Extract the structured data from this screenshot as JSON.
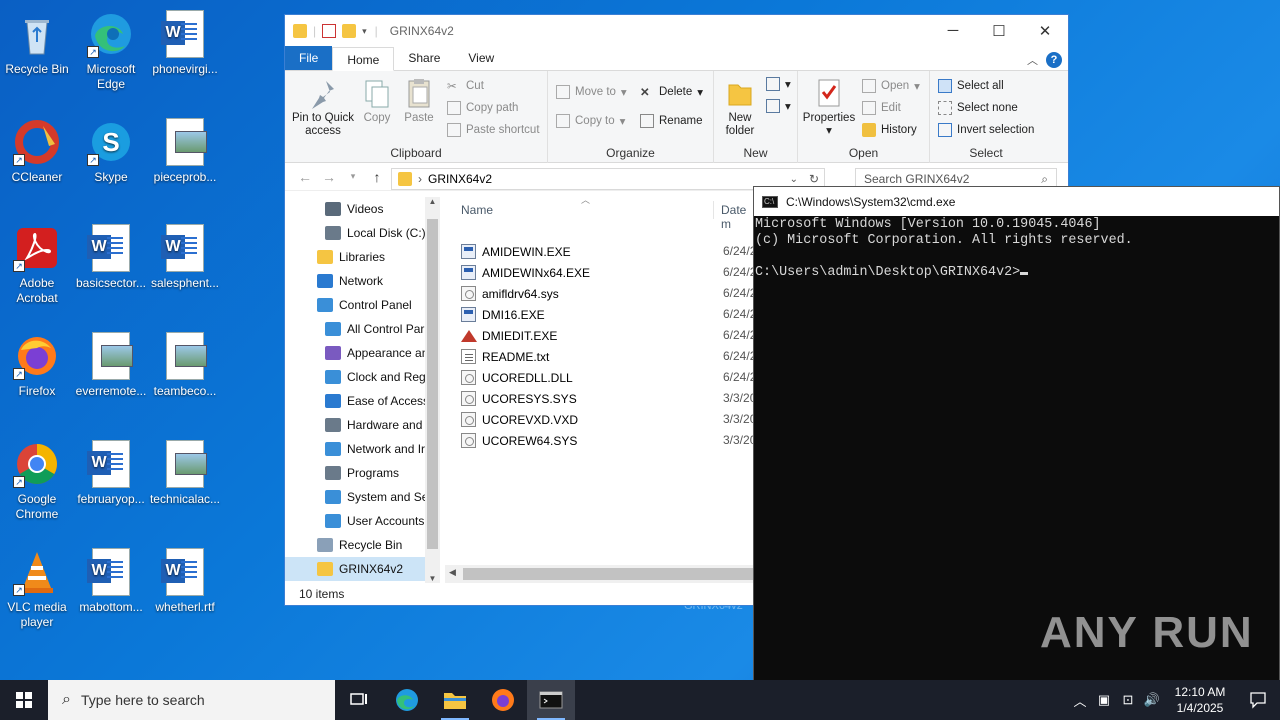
{
  "desktop": {
    "icons": [
      {
        "label": "Recycle Bin",
        "icon": "recycle-bin-icon"
      },
      {
        "label": "Microsoft Edge",
        "icon": "edge-icon"
      },
      {
        "label": "phonevirgi...",
        "icon": "word-document-icon"
      },
      {
        "label": "CCleaner",
        "icon": "ccleaner-icon"
      },
      {
        "label": "Skype",
        "icon": "skype-icon"
      },
      {
        "label": "pieceprob...",
        "icon": "image-file-icon"
      },
      {
        "label": "Adobe Acrobat",
        "icon": "acrobat-icon"
      },
      {
        "label": "basicsector...",
        "icon": "word-document-icon"
      },
      {
        "label": "salesphent...",
        "icon": "word-document-icon"
      },
      {
        "label": "Firefox",
        "icon": "firefox-icon"
      },
      {
        "label": "everremote...",
        "icon": "image-file-icon"
      },
      {
        "label": "teambeco...",
        "icon": "image-file-icon"
      },
      {
        "label": "Google Chrome",
        "icon": "chrome-icon"
      },
      {
        "label": "februaryop...",
        "icon": "word-document-icon"
      },
      {
        "label": "technicalac...",
        "icon": "image-file-icon"
      },
      {
        "label": "VLC media player",
        "icon": "vlc-icon"
      },
      {
        "label": "mabottom...",
        "icon": "word-document-icon"
      },
      {
        "label": "whetherl.rtf",
        "icon": "word-document-icon"
      }
    ]
  },
  "explorer": {
    "title": "GRINX64v2",
    "tabs": {
      "file": "File",
      "home": "Home",
      "share": "Share",
      "view": "View"
    },
    "ribbon": {
      "clipboard": {
        "label": "Clipboard",
        "pin": "Pin to Quick access",
        "copy": "Copy",
        "paste": "Paste",
        "cut": "Cut",
        "copy_path": "Copy path",
        "paste_shortcut": "Paste shortcut"
      },
      "organize": {
        "label": "Organize",
        "move_to": "Move to",
        "copy_to": "Copy to",
        "delete": "Delete",
        "rename": "Rename"
      },
      "new": {
        "label": "New",
        "new_folder": "New folder"
      },
      "open": {
        "label": "Open",
        "properties": "Properties",
        "open": "Open",
        "edit": "Edit",
        "history": "History"
      },
      "select": {
        "label": "Select",
        "select_all": "Select all",
        "select_none": "Select none",
        "invert": "Invert selection"
      }
    },
    "address": {
      "path": "GRINX64v2",
      "search_placeholder": "Search GRINX64v2"
    },
    "nav_items": [
      {
        "label": "Videos",
        "indent": 1
      },
      {
        "label": "Local Disk (C:)",
        "indent": 1
      },
      {
        "label": "Libraries",
        "indent": 0
      },
      {
        "label": "Network",
        "indent": 0
      },
      {
        "label": "Control Panel",
        "indent": 0
      },
      {
        "label": "All Control Par",
        "indent": 1
      },
      {
        "label": "Appearance an",
        "indent": 1
      },
      {
        "label": "Clock and Regi",
        "indent": 1
      },
      {
        "label": "Ease of Access",
        "indent": 1
      },
      {
        "label": "Hardware and",
        "indent": 1
      },
      {
        "label": "Network and Ir",
        "indent": 1
      },
      {
        "label": "Programs",
        "indent": 1
      },
      {
        "label": "System and Se",
        "indent": 1
      },
      {
        "label": "User Accounts",
        "indent": 1
      },
      {
        "label": "Recycle Bin",
        "indent": 0
      },
      {
        "label": "GRINX64v2",
        "indent": 0,
        "selected": true
      }
    ],
    "columns": {
      "name": "Name",
      "date": "Date m"
    },
    "files": [
      {
        "name": "AMIDEWIN.EXE",
        "date": "6/24/2",
        "type": "exe"
      },
      {
        "name": "AMIDEWINx64.EXE",
        "date": "6/24/2",
        "type": "exe"
      },
      {
        "name": "amifldrv64.sys",
        "date": "6/24/2",
        "type": "sys"
      },
      {
        "name": "DMI16.EXE",
        "date": "6/24/2",
        "type": "exe"
      },
      {
        "name": "DMIEDIT.EXE",
        "date": "6/24/2",
        "type": "edit"
      },
      {
        "name": "README.txt",
        "date": "6/24/2",
        "type": "txt"
      },
      {
        "name": "UCOREDLL.DLL",
        "date": "6/24/2",
        "type": "sys"
      },
      {
        "name": "UCORESYS.SYS",
        "date": "3/3/20",
        "type": "sys"
      },
      {
        "name": "UCOREVXD.VXD",
        "date": "3/3/20",
        "type": "sys"
      },
      {
        "name": "UCOREW64.SYS",
        "date": "3/3/20",
        "type": "sys"
      }
    ],
    "status": "10 items"
  },
  "cmd": {
    "title": "C:\\Windows\\System32\\cmd.exe",
    "lines": [
      "Microsoft Windows [Version 10.0.19045.4046]",
      "(c) Microsoft Corporation. All rights reserved.",
      "",
      "C:\\Users\\admin\\Desktop\\GRINX64v2>"
    ]
  },
  "background_label": "GRINX64v2",
  "watermark": "ANY RUN",
  "taskbar": {
    "search_placeholder": "Type here to search",
    "time": "12:10 AM",
    "date": "1/4/2025"
  }
}
